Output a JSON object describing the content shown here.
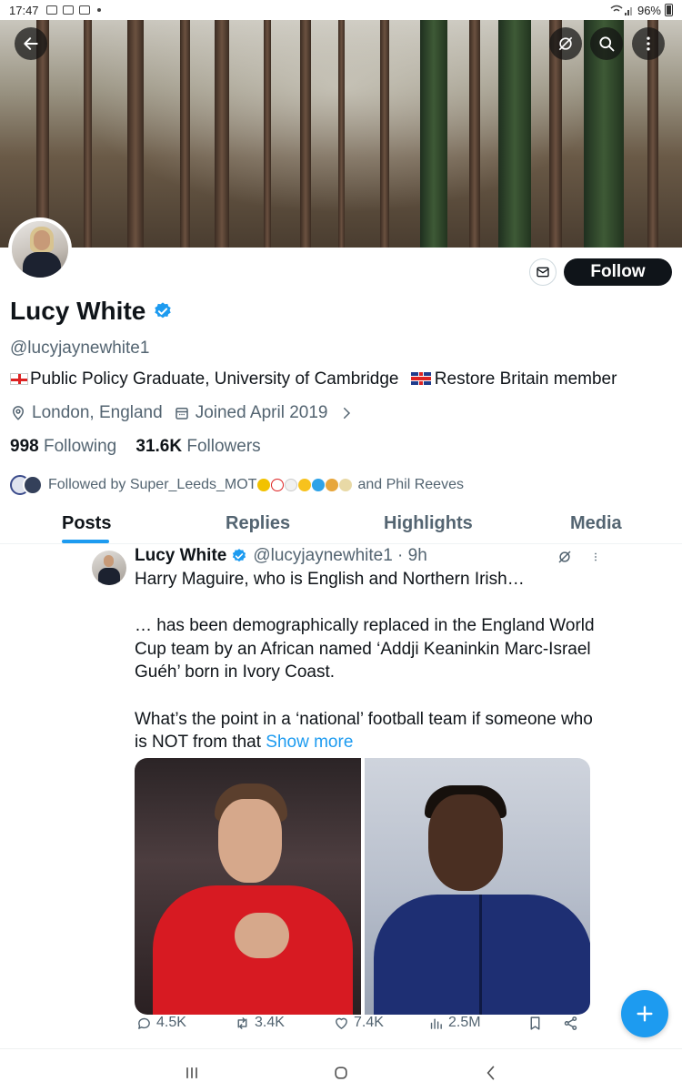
{
  "status_bar": {
    "time": "17:47",
    "battery": "96%"
  },
  "profile": {
    "display_name": "Lucy White",
    "handle": "@lucyjaynewhite1",
    "bio_part1": "Public Policy Graduate, University of Cambridge",
    "bio_part2": "Restore Britain member",
    "location": "London, England",
    "joined": "Joined April 2019",
    "following_count": "998",
    "following_label": "Following",
    "followers_count": "31.6K",
    "followers_label": "Followers",
    "followed_by_prefix": "Followed by Super_Leeds_MOT",
    "followed_by_suffix": "and Phil Reeves",
    "follow_button": "Follow"
  },
  "tabs": [
    "Posts",
    "Replies",
    "Highlights",
    "Media"
  ],
  "tweet": {
    "name": "Lucy White",
    "handle_time": "@lucyjaynewhite1 · 9h",
    "line1": "Harry Maguire, who is English and Northern Irish…",
    "line2": "… has been demographically replaced in the England World Cup team by an African named ‘Addji Keaninkin Marc-Israel Guéh’ born in Ivory Coast.",
    "line3": "What’s the point in a ‘national’ football team if someone who is NOT from that",
    "show_more": "Show more",
    "replies": "4.5K",
    "reposts": "3.4K",
    "likes": "7.4K",
    "views": "2.5M"
  },
  "colors": {
    "accent": "#1d9bf0",
    "text": "#0f1419",
    "muted": "#536471"
  },
  "icons": [
    "back-arrow-icon",
    "grok-icon",
    "search-icon",
    "more-vertical-icon",
    "mail-icon",
    "verified-icon",
    "location-icon",
    "calendar-icon",
    "chevron-right-icon",
    "reply-icon",
    "repost-icon",
    "like-icon",
    "views-icon",
    "bookmark-icon",
    "share-icon",
    "plus-icon"
  ]
}
